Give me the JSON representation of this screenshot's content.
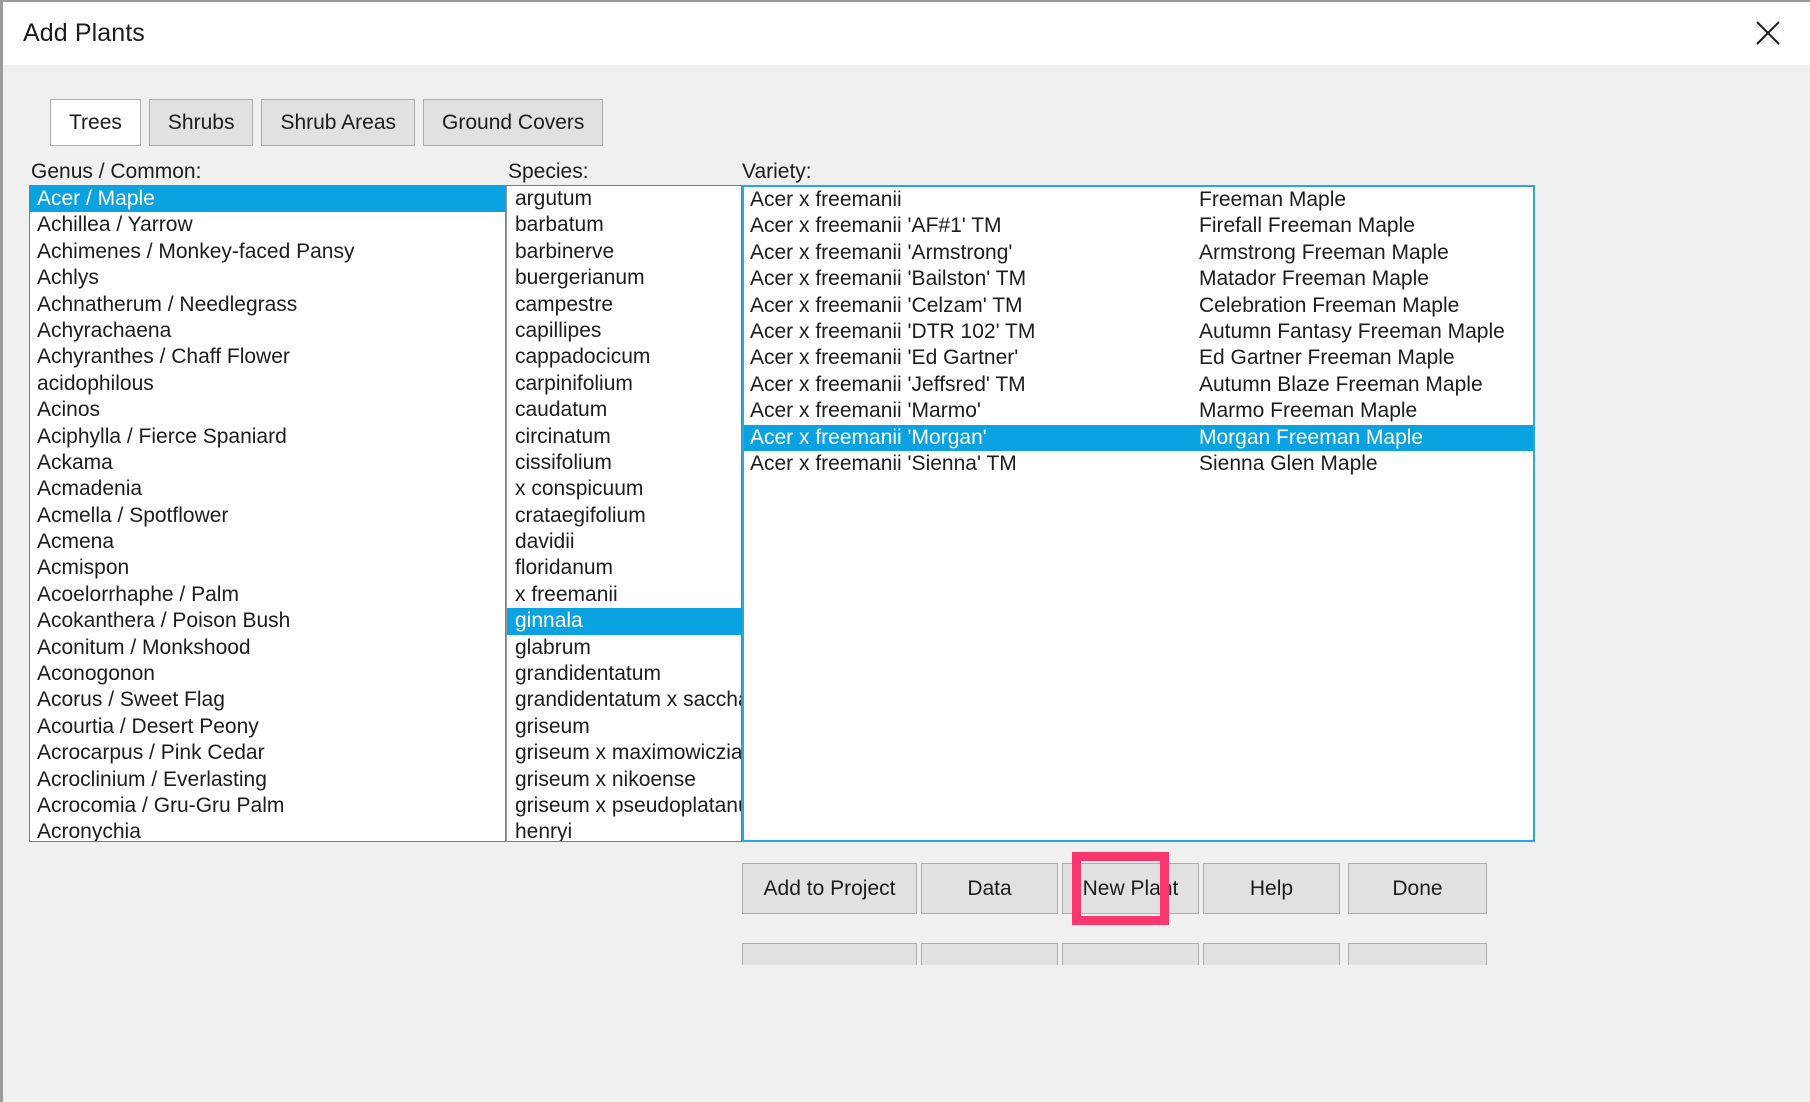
{
  "window": {
    "title": "Add Plants",
    "close_icon": "close-icon"
  },
  "tabs": [
    {
      "label": "Trees",
      "active": true
    },
    {
      "label": "Shrubs",
      "active": false
    },
    {
      "label": "Shrub Areas",
      "active": false
    },
    {
      "label": "Ground Covers",
      "active": false
    }
  ],
  "columns": {
    "genus_label": "Genus / Common:",
    "species_label": "Species:",
    "variety_label": "Variety:"
  },
  "genus_list": {
    "selected_index": 0,
    "items": [
      "Acer / Maple",
      "Achillea / Yarrow",
      "Achimenes / Monkey-faced Pansy",
      "Achlys",
      "Achnatherum / Needlegrass",
      "Achyrachaena",
      "Achyranthes / Chaff Flower",
      "acidophilous",
      "Acinos",
      "Aciphylla / Fierce Spaniard",
      "Ackama",
      "Acmadenia",
      "Acmella / Spotflower",
      "Acmena",
      "Acmispon",
      "Acoelorrhaphe / Palm",
      "Acokanthera / Poison Bush",
      "Aconitum / Monkshood",
      "Aconogonon",
      "Acorus / Sweet Flag",
      "Acourtia / Desert Peony",
      "Acrocarpus / Pink Cedar",
      "Acroclinium / Everlasting",
      "Acrocomia / Gru-Gru Palm",
      "Acronychia"
    ]
  },
  "species_list": {
    "selected_index": 16,
    "items": [
      "argutum",
      "barbatum",
      "barbinerve",
      "buergerianum",
      "campestre",
      "capillipes",
      "cappadocicum",
      "carpinifolium",
      "caudatum",
      "circinatum",
      "cissifolium",
      "x conspicuum",
      "crataegifolium",
      "davidii",
      "floridanum",
      "x freemanii",
      "ginnala",
      "glabrum",
      "grandidentatum",
      "grandidentatum x saccharum",
      "griseum",
      "griseum x maximowiczianum",
      "griseum x nikoense",
      "griseum x pseudoplatanus",
      "henryi"
    ]
  },
  "variety_list": {
    "selected_index": 9,
    "items": [
      {
        "scientific": "Acer x freemanii",
        "common": "Freeman Maple"
      },
      {
        "scientific": "Acer x freemanii 'AF#1'  TM",
        "common": "Firefall Freeman Maple"
      },
      {
        "scientific": "Acer x freemanii 'Armstrong'",
        "common": "Armstrong Freeman Maple"
      },
      {
        "scientific": "Acer x freemanii 'Bailston'  TM",
        "common": "Matador Freeman Maple"
      },
      {
        "scientific": "Acer x freemanii 'Celzam'  TM",
        "common": "Celebration Freeman Maple"
      },
      {
        "scientific": "Acer x freemanii 'DTR 102'  TM",
        "common": "Autumn Fantasy Freeman Maple"
      },
      {
        "scientific": "Acer x freemanii 'Ed Gartner'",
        "common": "Ed Gartner Freeman Maple"
      },
      {
        "scientific": "Acer x freemanii 'Jeffsred'  TM",
        "common": "Autumn Blaze Freeman Maple"
      },
      {
        "scientific": "Acer x freemanii 'Marmo'",
        "common": "Marmo Freeman Maple"
      },
      {
        "scientific": "Acer x freemanii 'Morgan'",
        "common": "Morgan Freeman Maple"
      },
      {
        "scientific": "Acer x freemanii 'Sienna'  TM",
        "common": "Sienna Glen Maple"
      }
    ]
  },
  "buttons": {
    "add_to_project": "Add to Project",
    "data": "Data",
    "new_plant": "New Plant",
    "help": "Help",
    "done": "Done"
  },
  "colors": {
    "selection": "#0aa2e0",
    "highlight_ring": "#f9376f",
    "focus_border": "#29a8e0",
    "dialog_bg": "#f0f0f0",
    "button_bg": "#e1e1e1"
  }
}
